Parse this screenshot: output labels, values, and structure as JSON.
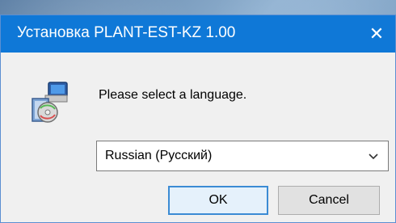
{
  "window": {
    "title": "Установка PLANT-EST-KZ 1.00",
    "close_icon": "close-icon"
  },
  "dialog": {
    "icon": "installer-icon",
    "prompt": "Please select a language.",
    "language_select": {
      "selected": "Russian (Русский)",
      "icon": "chevron-down-icon"
    },
    "buttons": {
      "ok": "OK",
      "cancel": "Cancel"
    }
  },
  "colors": {
    "titlebar": "#0f78d7",
    "dialog_background": "#f0f0f0",
    "ok_border": "#3b8bd4"
  }
}
